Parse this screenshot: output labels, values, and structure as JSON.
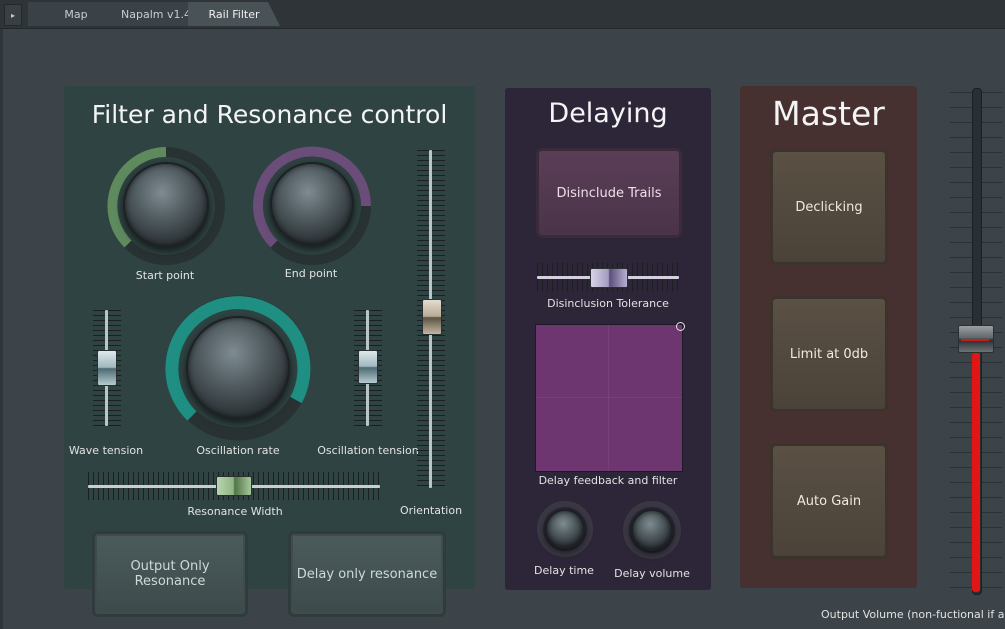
{
  "tabs": [
    {
      "label": "Map"
    },
    {
      "label": "Napalm v1.4"
    },
    {
      "label": "Rail Filter",
      "active": true
    }
  ],
  "filter_panel": {
    "title": "Filter and Resonance control",
    "start_point": {
      "label": "Start point"
    },
    "end_point": {
      "label": "End point"
    },
    "wave_tension": {
      "label": "Wave tension"
    },
    "oscillation_rate": {
      "label": "Oscillation rate"
    },
    "oscillation_tension": {
      "label": "Oscillation tension"
    },
    "orientation": {
      "label": "Orientation"
    },
    "resonance_width": {
      "label": "Resonance Width"
    },
    "output_only_resonance": {
      "label": "Output Only Resonance"
    },
    "delay_only_resonance": {
      "label": "Delay only resonance"
    }
  },
  "delay_panel": {
    "title": "Delaying",
    "disinclude_trails": {
      "label": "Disinclude Trails"
    },
    "disinclusion_tolerance": {
      "label": "Disinclusion Tolerance"
    },
    "delay_feedback": {
      "label": "Delay feedback and filter"
    },
    "delay_time": {
      "label": "Delay time"
    },
    "delay_volume": {
      "label": "Delay volume"
    }
  },
  "master_panel": {
    "title": "Master",
    "declicking": {
      "label": "Declicking"
    },
    "limit": {
      "label": "Limit at 0db"
    },
    "auto_gain": {
      "label": "Auto Gain"
    }
  },
  "output_volume": {
    "label": "Output Volume (non-fuctional if aut"
  },
  "colors": {
    "filter_panel": "#2f4342",
    "delay_panel": "#2d2638",
    "master_panel": "#463030",
    "teal_arc": "#1f8f84",
    "green_arc": "#5e8a5e",
    "purple_arc": "#6a4d79",
    "xy_pad": "#6d3670",
    "volume_red": "#e01515"
  },
  "icons": {
    "tab_arrow": "play-arrow-icon"
  }
}
